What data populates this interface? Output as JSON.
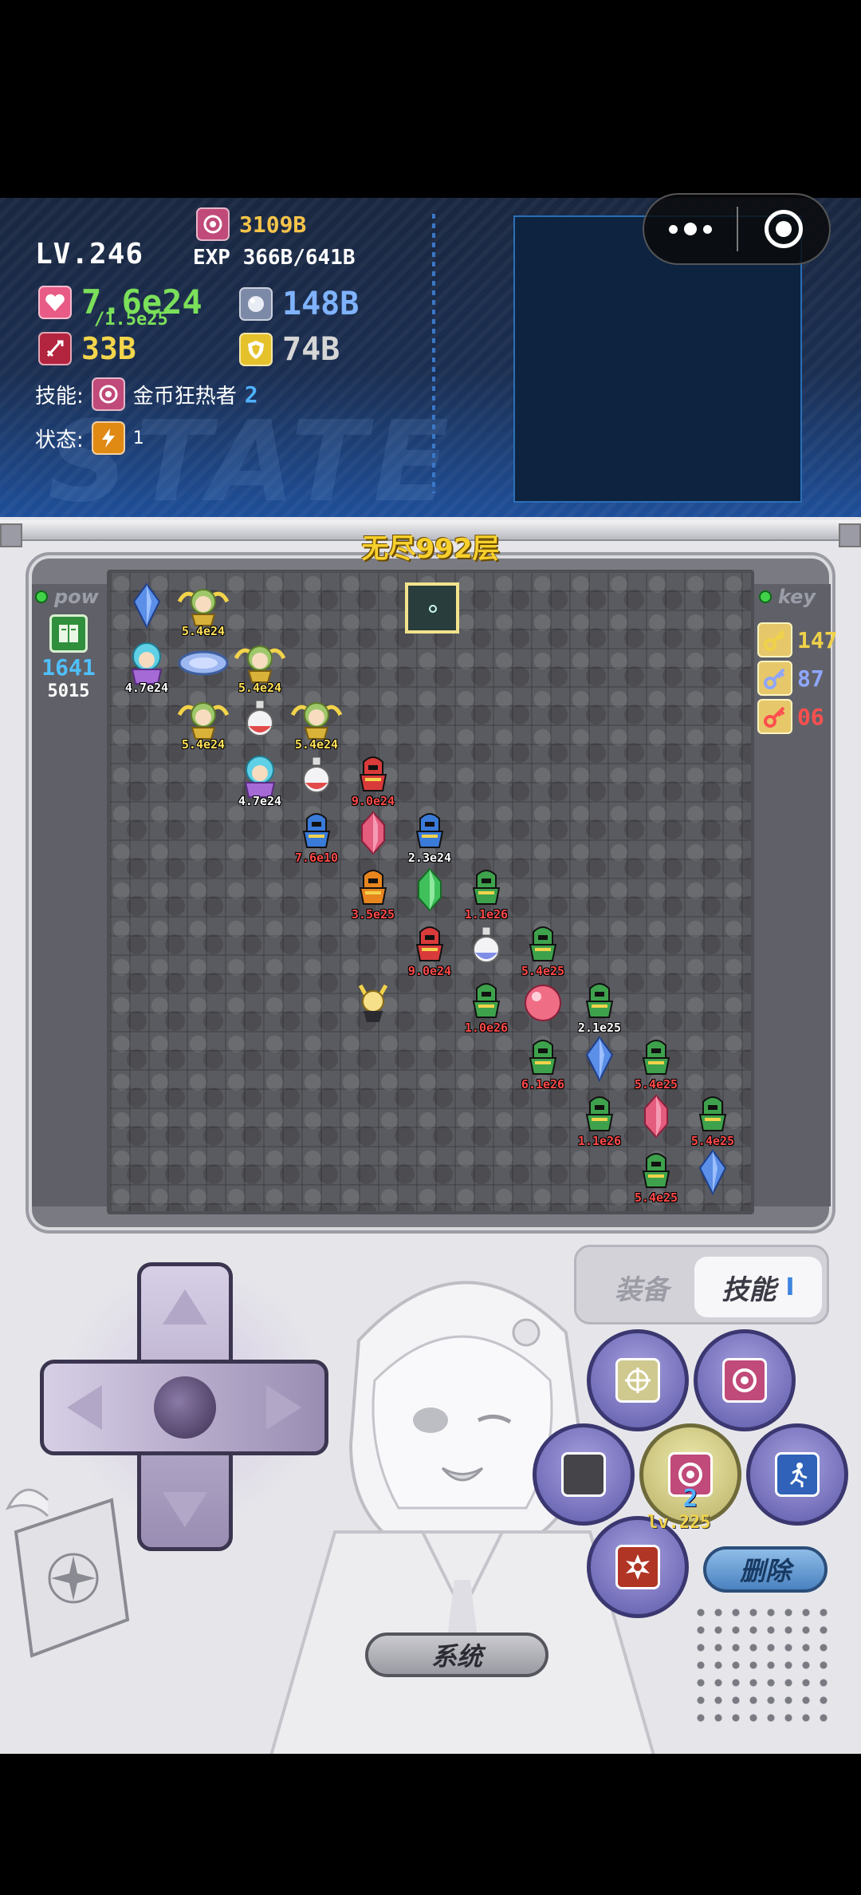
{
  "header": {
    "level": "LV.246",
    "gold": "3109B",
    "exp": "EXP 366B/641B",
    "hp": "7.6e24",
    "hp_max": "/1.5e25",
    "atk": "33B",
    "magic": "148B",
    "def": "74B",
    "skill_label": "技能:",
    "skill_name": "金币狂热者",
    "skill_level": "2",
    "status_label": "状态:",
    "status_count": "1",
    "watermark": "STATE"
  },
  "capsule": {
    "more_icon": "more-dots-icon",
    "close_icon": "close-target-icon"
  },
  "floor_title": "无尽992层",
  "left_panel": {
    "label": "pow",
    "value": "1641",
    "sub_value": "5015"
  },
  "right_panel": {
    "label": "key",
    "keys": [
      {
        "color": "#f0d24a",
        "count": "147"
      },
      {
        "color": "#8fa6ff",
        "count": "87"
      },
      {
        "color": "#ff4f4f",
        "count": "06"
      }
    ]
  },
  "board": {
    "units": [
      {
        "kind": "gem-blue",
        "col": 0,
        "row": 0,
        "label": ""
      },
      {
        "kind": "angel",
        "col": 1,
        "row": 0,
        "label": "5.4e24",
        "label_color": "#ffe15a"
      },
      {
        "kind": "mage",
        "col": 0,
        "row": 1,
        "label": "4.7e24",
        "label_color": "#ffffff"
      },
      {
        "kind": "shield",
        "col": 1,
        "row": 1,
        "label": ""
      },
      {
        "kind": "angel",
        "col": 2,
        "row": 1,
        "label": "5.4e24",
        "label_color": "#ffe15a"
      },
      {
        "kind": "angel",
        "col": 1,
        "row": 2,
        "label": "5.4e24",
        "label_color": "#ffe15a"
      },
      {
        "kind": "potion-red",
        "col": 2,
        "row": 2,
        "label": ""
      },
      {
        "kind": "angel",
        "col": 3,
        "row": 2,
        "label": "5.4e24",
        "label_color": "#ffe15a"
      },
      {
        "kind": "mage",
        "col": 2,
        "row": 3,
        "label": "4.7e24",
        "label_color": "#ffffff"
      },
      {
        "kind": "potion-red",
        "col": 3,
        "row": 3,
        "label": ""
      },
      {
        "kind": "knight-red",
        "col": 4,
        "row": 3,
        "label": "9.0e24",
        "label_color": "#ff4a4a"
      },
      {
        "kind": "knight-blue",
        "col": 3,
        "row": 4,
        "label": "7.6e10",
        "label_color": "#ff4a4a"
      },
      {
        "kind": "gem-pink",
        "col": 4,
        "row": 4,
        "label": ""
      },
      {
        "kind": "knight-blue",
        "col": 5,
        "row": 4,
        "label": "2.3e24",
        "label_color": "#ffffff"
      },
      {
        "kind": "knight-orange",
        "col": 4,
        "row": 5,
        "label": "3.5e25",
        "label_color": "#ff4a4a"
      },
      {
        "kind": "gem-green",
        "col": 5,
        "row": 5,
        "label": ""
      },
      {
        "kind": "knight-green",
        "col": 6,
        "row": 5,
        "label": "1.1e26",
        "label_color": "#ff4a4a"
      },
      {
        "kind": "knight-red",
        "col": 5,
        "row": 6,
        "label": "9.0e24",
        "label_color": "#ff4a4a"
      },
      {
        "kind": "potion-blue",
        "col": 6,
        "row": 6,
        "label": ""
      },
      {
        "kind": "knight-green",
        "col": 7,
        "row": 6,
        "label": "5.4e25",
        "label_color": "#ff4a4a"
      },
      {
        "kind": "hero",
        "col": 4,
        "row": 7,
        "label": ""
      },
      {
        "kind": "knight-green",
        "col": 6,
        "row": 7,
        "label": "1.0e26",
        "label_color": "#ff4a4a"
      },
      {
        "kind": "orb-pink",
        "col": 7,
        "row": 7,
        "label": ""
      },
      {
        "kind": "knight-green",
        "col": 8,
        "row": 7,
        "label": "2.1e25",
        "label_color": "#ffffff"
      },
      {
        "kind": "knight-green",
        "col": 7,
        "row": 8,
        "label": "6.1e26",
        "label_color": "#ff4a4a"
      },
      {
        "kind": "gem-blue",
        "col": 8,
        "row": 8,
        "label": ""
      },
      {
        "kind": "knight-green",
        "col": 9,
        "row": 8,
        "label": "5.4e25",
        "label_color": "#ff4a4a"
      },
      {
        "kind": "knight-green",
        "col": 8,
        "row": 9,
        "label": "1.1e26",
        "label_color": "#ff4a4a"
      },
      {
        "kind": "gem-pink",
        "col": 9,
        "row": 9,
        "label": ""
      },
      {
        "kind": "knight-green",
        "col": 10,
        "row": 9,
        "label": "5.4e25",
        "label_color": "#ff4a4a"
      },
      {
        "kind": "knight-green",
        "col": 9,
        "row": 10,
        "label": "5.4e25",
        "label_color": "#ff4a4a"
      },
      {
        "kind": "gem-blue",
        "col": 10,
        "row": 10,
        "label": ""
      }
    ]
  },
  "controls": {
    "tab_equip": "装备",
    "tab_skill": "技能",
    "tab_skill_page": "I",
    "center_skill_level": "2",
    "center_skill_lv": "lv.225",
    "delete_label": "删除",
    "system_label": "系统"
  }
}
